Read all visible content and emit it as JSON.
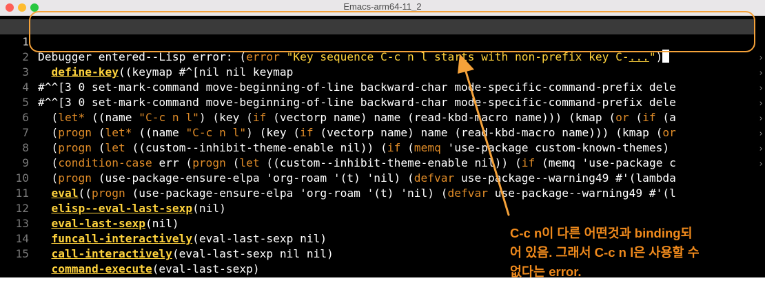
{
  "window": {
    "title": "Emacs-arm64-11_2"
  },
  "accent_color": "#f5a23a",
  "lines": {
    "l1": {
      "n": "1",
      "a": "Debugger entered--Lisp error: (",
      "b": "error",
      "c": " ",
      "d": "\"Key sequence C-c n l starts with non-prefix key C-",
      "e": "...",
      "f": "\"",
      "g": ")"
    },
    "l2": {
      "n": "2",
      "fn": "define-key",
      "rest": "((keymap #^[nil nil keymap"
    },
    "l3": {
      "n": "3",
      "text": "#^^[3 0 set-mark-command move-beginning-of-line backward-char mode-specific-command-prefix dele"
    },
    "l4": {
      "n": "4",
      "text": "#^^[3 0 set-mark-command move-beginning-of-line backward-char mode-specific-command-prefix dele"
    },
    "l5": {
      "n": "5",
      "a": "(",
      "k1": "let*",
      "b": " ((name ",
      "s1": "\"C-c n l\"",
      "c": ") (key (",
      "k2": "if",
      "d": " (vectorp name) name (read-kbd-macro name))) (kmap (",
      "k3": "or",
      "e": " (",
      "k4": "if",
      "f": " (a"
    },
    "l6": {
      "n": "6",
      "a": "(",
      "k1": "progn",
      "b": " (",
      "k2": "let*",
      "c": " ((name ",
      "s1": "\"C-c n l\"",
      "d": ") (key (",
      "k3": "if",
      "e": " (vectorp name) name (read-kbd-macro name))) (kmap (",
      "k4": "or"
    },
    "l7": {
      "n": "7",
      "a": "(",
      "k1": "progn",
      "b": " (",
      "k2": "let",
      "c": " ((custom--inhibit-theme-enable nil)) (",
      "k3": "if",
      "d": " (",
      "k4": "memq",
      "e": " 'use-package custom-known-themes) "
    },
    "l8": {
      "n": "8",
      "a": "(",
      "k1": "condition-case",
      "b": " err (",
      "k2": "progn",
      "c": " (",
      "k3": "let",
      "d": " ((custom--inhibit-theme-enable nil)) (",
      "k4": "if",
      "e": " (memq 'use-package c"
    },
    "l9": {
      "n": "9",
      "a": "(",
      "k1": "progn",
      "b": " (use-package-ensure-elpa 'org-roam '(t) 'nil) (",
      "k2": "defvar",
      "c": " use-package--warning49 #'(lambda"
    },
    "l10": {
      "n": "10",
      "fn": "eval",
      "a": "((",
      "k1": "progn",
      "b": " (use-package-ensure-elpa 'org-roam '(t) 'nil) (",
      "k2": "defvar",
      "c": " use-package--warning49 #'(l"
    },
    "l11": {
      "n": "11",
      "fn": "elisp--eval-last-sexp",
      "rest": "(nil)"
    },
    "l12": {
      "n": "12",
      "fn": "eval-last-sexp",
      "rest": "(nil)"
    },
    "l13": {
      "n": "13",
      "fn": "funcall-interactively",
      "rest": "(eval-last-sexp nil)"
    },
    "l14": {
      "n": "14",
      "fn": "call-interactively",
      "rest": "(eval-last-sexp nil nil)"
    },
    "l15": {
      "n": "15",
      "fn": "command-execute",
      "rest": "(eval-last-sexp)"
    }
  },
  "annotation": {
    "line1": "C-c n이 다른 어떤것과 binding되",
    "line2": "어 있음. 그래서 C-c n l은 사용할 수",
    "line3": "없다는 error."
  }
}
